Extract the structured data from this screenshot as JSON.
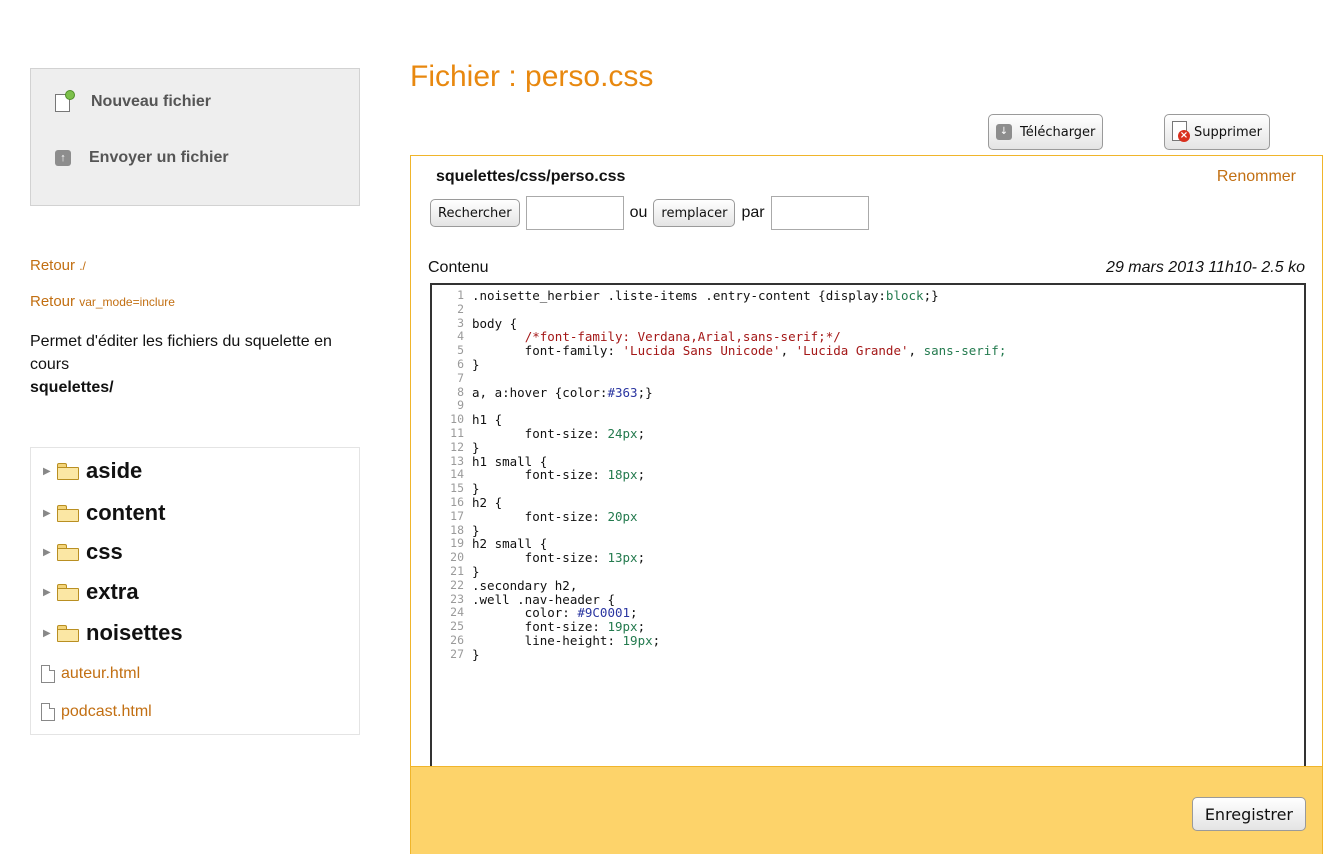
{
  "sidebar": {
    "actions": [
      {
        "label": "Nouveau fichier",
        "icon": "new-file-icon"
      },
      {
        "label": "Envoyer un fichier",
        "icon": "upload-icon"
      }
    ],
    "retour1": {
      "label": "Retour",
      "path": "./"
    },
    "retour2": {
      "label": "Retour",
      "path": "var_mode=inclure"
    },
    "description": "Permet d'éditer les fichiers du squelette en cours",
    "squelette": "squelettes/",
    "folders": [
      "aside",
      "content",
      "css",
      "extra",
      "noisettes"
    ],
    "files": [
      "auteur.html",
      "podcast.html"
    ]
  },
  "main": {
    "title": "Fichier : perso.css",
    "download_label": "Télécharger",
    "delete_label": "Supprimer",
    "path": "squelettes/css/perso.css",
    "rename_label": "Renommer",
    "search_button": "Rechercher",
    "ou": "ou",
    "replace_button": "remplacer",
    "par": "par",
    "search_value": "",
    "replace_value": "",
    "contenu_label": "Contenu",
    "meta": "29 mars 2013 11h10- 2.5 ko",
    "save_label": "Enregistrer",
    "code_lines": [
      ".noisette_herbier .liste-items .entry-content {display:block;}",
      "",
      "body {",
      "       /*font-family: Verdana,Arial,sans-serif;*/",
      "       font-family: 'Lucida Sans Unicode', 'Lucida Grande', sans-serif;",
      "}",
      "",
      "a, a:hover {color:#363;}",
      "",
      "h1 {",
      "       font-size: 24px;",
      "}",
      "h1 small {",
      "       font-size: 18px;",
      "}",
      "h2 {",
      "       font-size: 20px",
      "}",
      "h2 small {",
      "       font-size: 13px;",
      "}",
      ".secondary h2,",
      ".well .nav-header {",
      "       color: #9C0001;",
      "       font-size: 19px;",
      "       line-height: 19px;",
      "}"
    ]
  },
  "colors": {
    "accent_orange": "#e8880f",
    "link_orange": "#c26f12",
    "panel_border": "#f0b52b",
    "save_bar": "#fdd36a"
  }
}
